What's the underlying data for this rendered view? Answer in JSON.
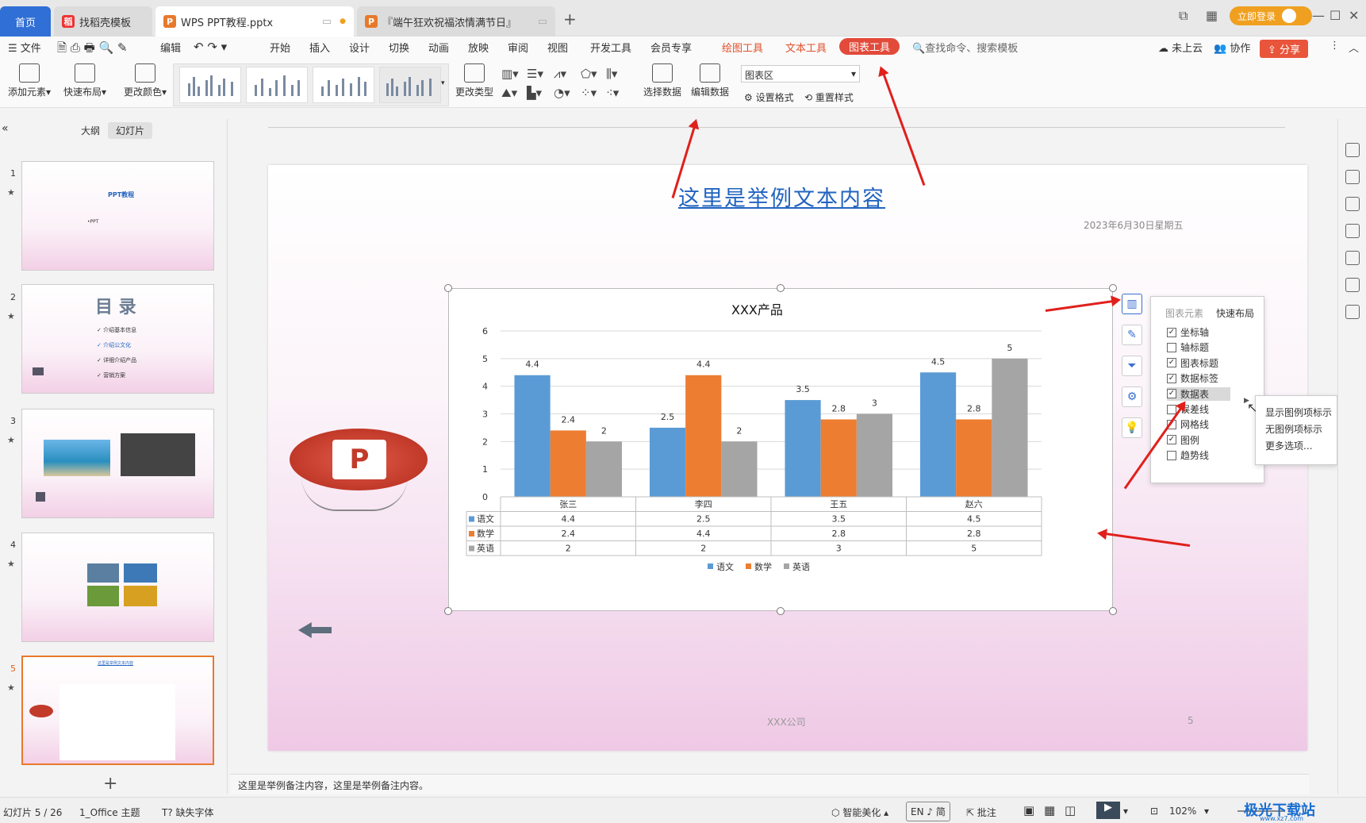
{
  "tabs": {
    "home": "首页",
    "template": "找稻壳模板",
    "ppt": "WPS PPT教程.pptx",
    "dragon": "『端午狂欢祝福浓情满节日』"
  },
  "titlebar": {
    "login": "立即登录"
  },
  "menu": {
    "file": "文件",
    "edit": "编辑",
    "items": [
      "开始",
      "插入",
      "设计",
      "切换",
      "动画",
      "放映",
      "审阅",
      "视图",
      "开发工具",
      "会员专享"
    ],
    "draw_tool": "绘图工具",
    "text_tool": "文本工具",
    "chart_tool": "图表工具",
    "search": "查找命令、搜索模板",
    "cloud": "未上云",
    "collab": "协作",
    "share": "分享"
  },
  "ribbon": {
    "add_element": "添加元素",
    "quick_layout": "快速布局",
    "change_color": "更改颜色",
    "change_type": "更改类型",
    "select_data": "选择数据",
    "edit_data": "编辑数据",
    "chart_area": "图表区",
    "set_format": "设置格式",
    "reset_style": "重置样式"
  },
  "panel": {
    "outline": "大纲",
    "slides": "幻灯片"
  },
  "thumbs": {
    "t1_title": "PPT教程",
    "t1_sub": "•PPT",
    "t2_title": "目 录",
    "t2_items": [
      "介绍基本信息",
      "介绍公文化",
      "详细介绍产品",
      "营销方案"
    ]
  },
  "slide": {
    "title": "这里是举例文本内容",
    "date": "2023年6月30日星期五",
    "footer_company": "XXX公司",
    "page_num": "5"
  },
  "chart_data": {
    "type": "bar",
    "title": "XXX产品",
    "categories": [
      "张三",
      "李四",
      "王五",
      "赵六"
    ],
    "series": [
      {
        "name": "语文",
        "values": [
          4.4,
          2.5,
          3.5,
          4.5
        ],
        "color": "#5b9bd5"
      },
      {
        "name": "数学",
        "values": [
          2.4,
          4.4,
          2.8,
          2.8
        ],
        "color": "#ed7d31"
      },
      {
        "name": "英语",
        "values": [
          2,
          2,
          3,
          5
        ],
        "color": "#a5a5a5"
      }
    ],
    "ylim": [
      0,
      6
    ],
    "yticks": [
      0,
      1,
      2,
      3,
      4,
      5,
      6
    ],
    "grid": true,
    "data_table": true,
    "legend": "bottom"
  },
  "elements_panel": {
    "tab_elements": "图表元素",
    "tab_layout": "快速布局",
    "items": [
      {
        "label": "坐标轴",
        "checked": true
      },
      {
        "label": "轴标题",
        "checked": false
      },
      {
        "label": "图表标题",
        "checked": true
      },
      {
        "label": "数据标签",
        "checked": true
      },
      {
        "label": "数据表",
        "checked": true
      },
      {
        "label": "误差线",
        "checked": false
      },
      {
        "label": "网格线",
        "checked": true
      },
      {
        "label": "图例",
        "checked": true
      },
      {
        "label": "趋势线",
        "checked": false
      }
    ],
    "sub": [
      "显示图例项标示",
      "无图例项标示",
      "更多选项..."
    ]
  },
  "notes": "这里是举例备注内容，这里是举例备注内容。",
  "status": {
    "slide_pos": "幻灯片 5 / 26",
    "theme": "1_Office 主题",
    "missing_font": "缺失字体",
    "beautify": "智能美化",
    "ime": "EN ♪ 简",
    "annotate": "批注",
    "zoom": "102%"
  },
  "watermark": "极光下载站",
  "watermark_url": "www.xz7.com"
}
